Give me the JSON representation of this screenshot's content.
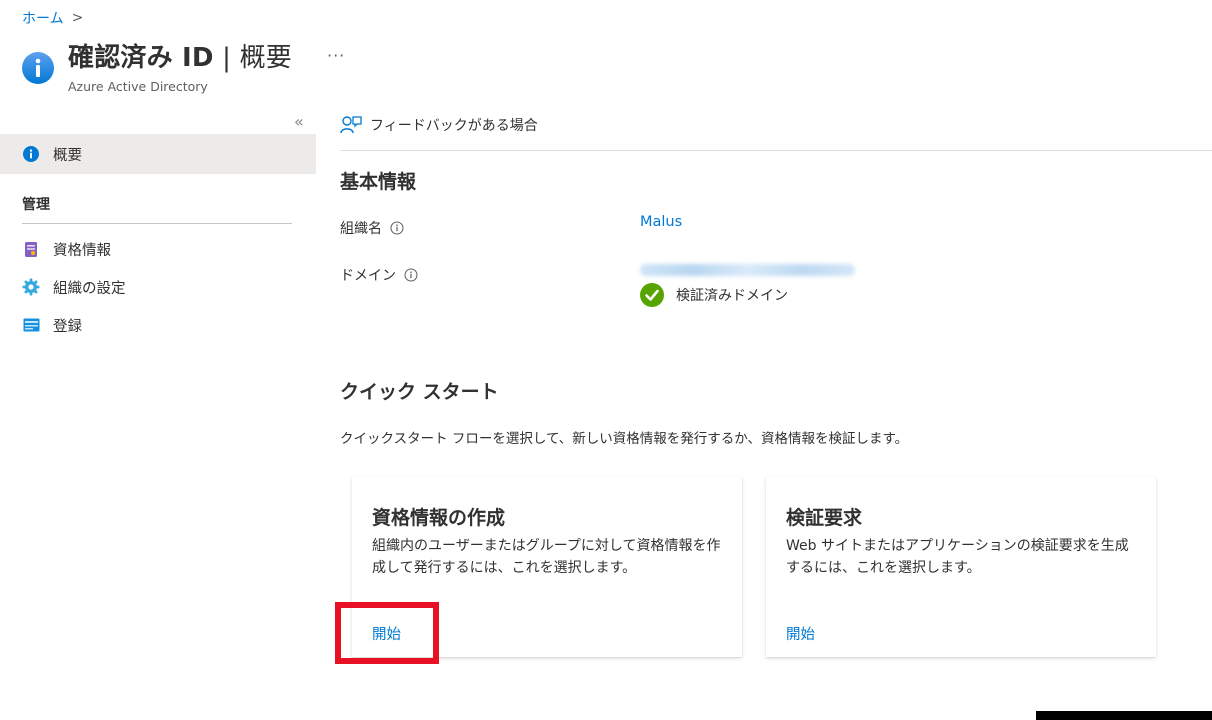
{
  "breadcrumb": {
    "home": "ホーム",
    "separator": ">"
  },
  "header": {
    "title_main": "確認済み ID",
    "title_sep": " | ",
    "title_sub": "概要",
    "subtitle": "Azure Active Directory",
    "more": "···"
  },
  "sidebar": {
    "collapse": "«",
    "overview": "概要",
    "section_manage": "管理",
    "items": [
      {
        "label": "資格情報",
        "icon": "credential-icon"
      },
      {
        "label": "組織の設定",
        "icon": "gear-icon"
      },
      {
        "label": "登録",
        "icon": "registration-icon"
      }
    ]
  },
  "commandbar": {
    "feedback": "フィードバックがある場合"
  },
  "basics": {
    "heading": "基本情報",
    "org_label": "組織名",
    "org_value": "Malus",
    "domain_label": "ドメイン",
    "domain_status": "検証済みドメイン"
  },
  "quickstart": {
    "heading": "クイック スタート",
    "description": "クイックスタート フローを選択して、新しい資格情報を発行するか、資格情報を検証します。",
    "cards": [
      {
        "title": "資格情報の作成",
        "description": "組織内のユーザーまたはグループに対して資格情報を作成して発行するには、これを選択します。",
        "link": "開始"
      },
      {
        "title": "検証要求",
        "description": "Web サイトまたはアプリケーションの検証要求を生成するには、これを選択します。",
        "link": "開始"
      }
    ]
  },
  "colors": {
    "accent": "#0078d4",
    "highlight": "#e81123",
    "success": "#57a300"
  }
}
